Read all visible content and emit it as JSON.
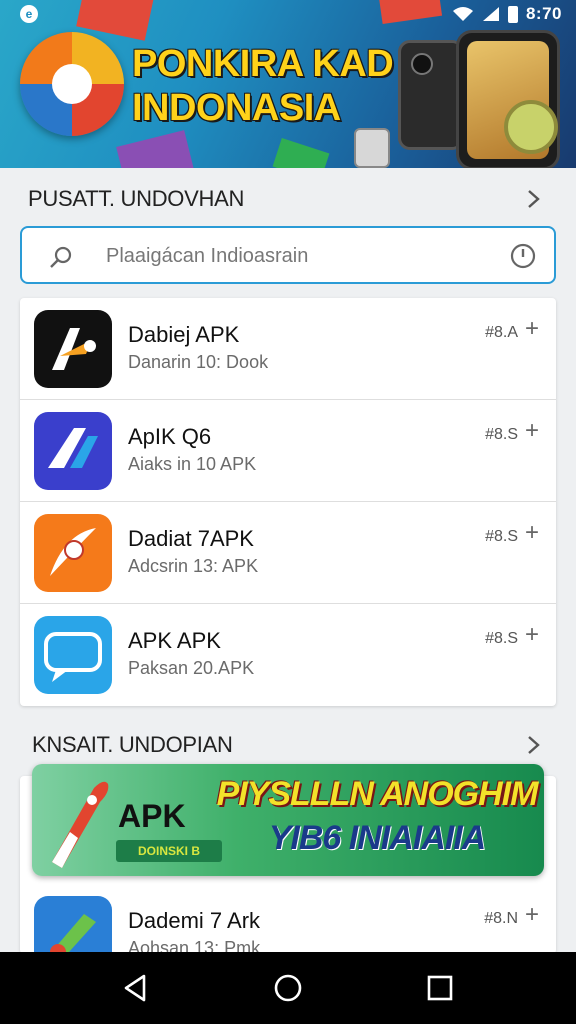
{
  "status_bar": {
    "time": "8:70",
    "left_icon": "app-notification-icon",
    "icons": [
      "wifi-icon",
      "signal-icon",
      "battery-icon"
    ]
  },
  "hero": {
    "title_line1": "PONKIRA KAD",
    "title_line2": "INDONASIA"
  },
  "section1": {
    "title": "PUSATT. UNDOVHAN",
    "chevron_icon": "chevron-right-icon"
  },
  "search": {
    "placeholder": "Plaaigácan Indioasrain",
    "icons": [
      "search-icon",
      "clock-icon"
    ]
  },
  "apps": [
    {
      "name": "Dabiej APK",
      "sub": "Danarin 10: Dook",
      "size": "#8.A",
      "icon_color": "#111111",
      "accent": "#f5a021"
    },
    {
      "name": "ApIK Q6",
      "sub": "Aiaks in 10 APK",
      "size": "#8.S",
      "icon_color": "#3a3fcc",
      "accent": "#2aa5e8"
    },
    {
      "name": "Dadiat 7APK",
      "sub": "Adcsrin 13: APK",
      "size": "#8.S",
      "icon_color": "#f57a1a",
      "accent": "#ffffff"
    },
    {
      "name": "APK APK",
      "sub": "Paksan 20.APK",
      "size": "#8.S",
      "icon_color": "#2aa5e8",
      "accent": "#ffffff"
    }
  ],
  "section2": {
    "title": "KNSAIT. UNDOPIAN",
    "chevron_icon": "chevron-right-icon"
  },
  "promo": {
    "apk_label": "APK",
    "tag": "DOINSKI B",
    "headline1": "PIYSLLLN ANOGHIM",
    "headline2": "YIB6 INIAIAIIA"
  },
  "apps2": [
    {
      "name": "Dademi 7 Ark",
      "sub": "Aohsan 13: Pmk",
      "size": "#8.N",
      "icon_color": "#2a7fd6",
      "accent": "#6cc24a"
    }
  ],
  "nav": {
    "icons": [
      "back-icon",
      "home-icon",
      "recents-icon"
    ]
  }
}
